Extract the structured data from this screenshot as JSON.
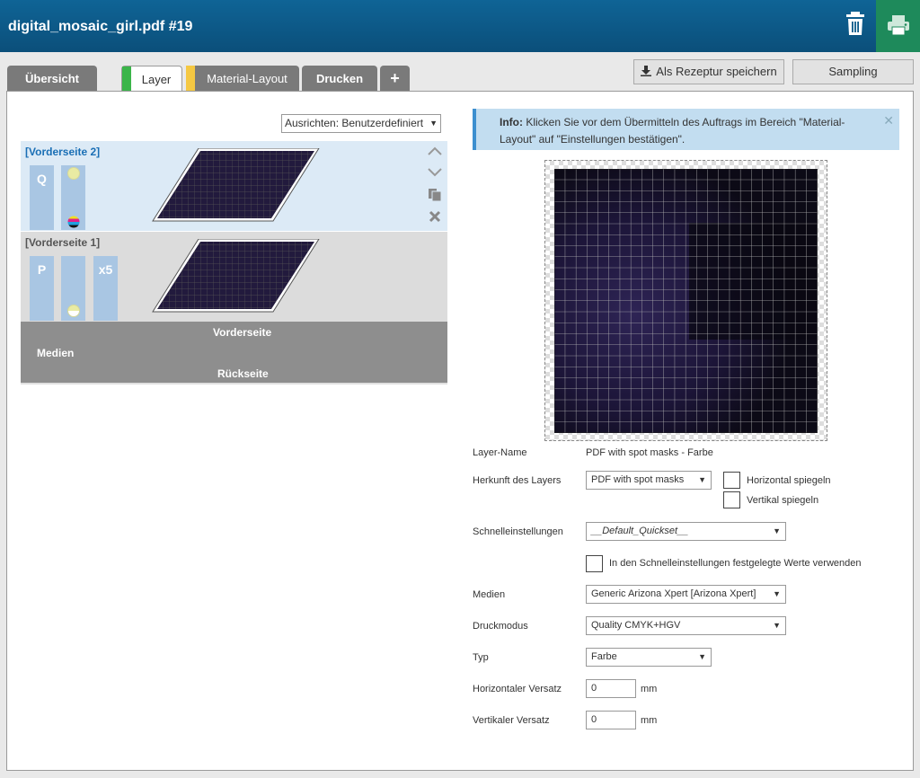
{
  "header": {
    "title": "digital_mosaic_girl.pdf #19",
    "trash_icon": "trash-icon",
    "print_icon": "printer-icon"
  },
  "tabs": [
    {
      "label": "Übersicht"
    },
    {
      "label": "Layer",
      "marker_color": "#3bb54a"
    },
    {
      "label": "Material-Layout",
      "marker_color": "#f5c842"
    },
    {
      "label": "Drucken"
    },
    {
      "label": "+"
    }
  ],
  "toolbar": {
    "save_recipe_label": "Als Rezeptur speichern",
    "sampling_label": "Sampling"
  },
  "layers_panel": {
    "align_select": "Ausrichten: Benutzerdefiniert",
    "layers": [
      {
        "name": "[Vorderseite 2]",
        "chip1": "Q",
        "chip2": "",
        "chip3": ""
      },
      {
        "name": "[Vorderseite 1]",
        "chip1": "P",
        "chip2": "",
        "chip3": "x5"
      }
    ],
    "media_bar": {
      "front": "Vorderseite",
      "media": "Medien",
      "back": "Rückseite"
    }
  },
  "info": {
    "title": "Info:",
    "text": "Klicken Sie vor dem Übermitteln des Auftrags im Bereich \"Material-Layout\" auf \"Einstellungen bestätigen\"."
  },
  "form": {
    "layer_name_label": "Layer-Name",
    "layer_name_value": "PDF with spot masks - Farbe",
    "origin_label": "Herkunft des Layers",
    "origin_value": "PDF with spot masks",
    "flip_h_label": "Horizontal spiegeln",
    "flip_v_label": "Vertikal spiegeln",
    "quickset_label": "Schnelleinstellungen",
    "quickset_value": "__Default_Quickset__",
    "use_quickset_label": "In den Schnelleinstellungen festgelegte Werte verwenden",
    "media_label": "Medien",
    "media_value": "Generic Arizona Xpert [Arizona Xpert]",
    "print_mode_label": "Druckmodus",
    "print_mode_value": "Quality CMYK+HGV",
    "type_label": "Typ",
    "type_value": "Farbe",
    "h_offset_label": "Horizontaler Versatz",
    "h_offset_value": "0",
    "v_offset_label": "Vertikaler Versatz",
    "v_offset_value": "0",
    "unit": "mm"
  }
}
